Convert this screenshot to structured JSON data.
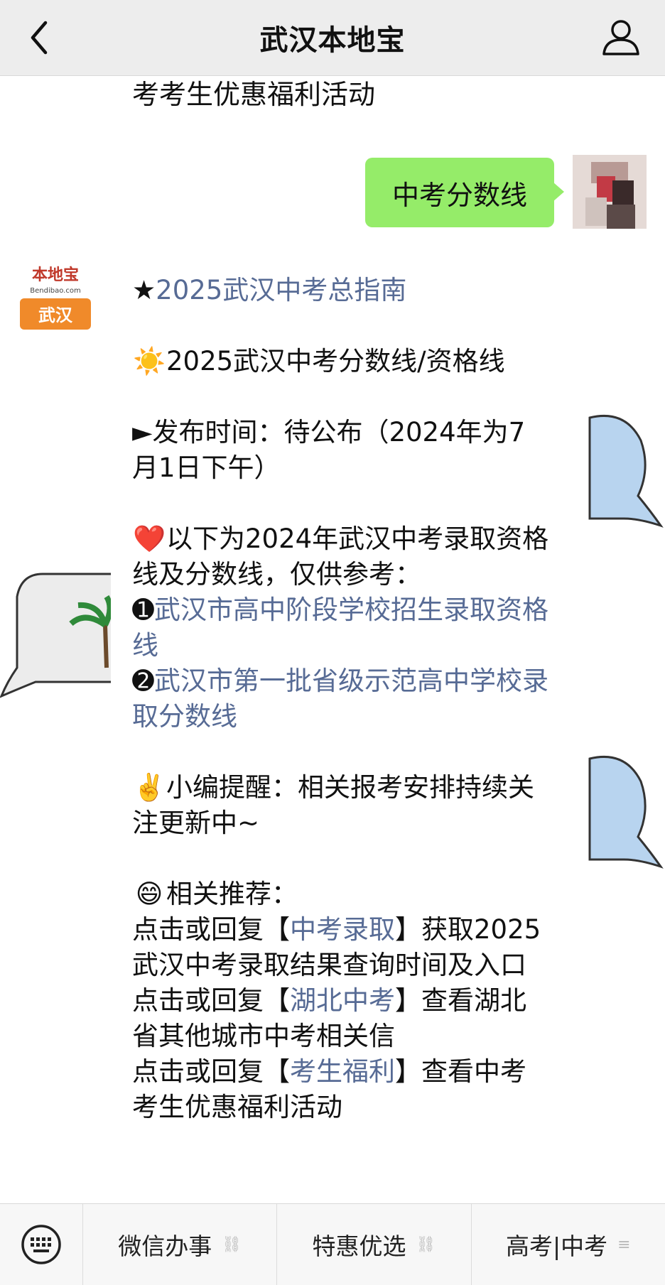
{
  "header": {
    "title": "武汉本地宝",
    "back_icon": "chevron-left-icon",
    "profile_icon": "person-icon"
  },
  "chat": {
    "previous_tail": "考考生优惠福利活动",
    "user_message": "中考分数线",
    "bot_avatar": {
      "top": "本地宝",
      "sub": "Bendibao.com",
      "city": "武汉",
      "accent": "#f08a2a"
    },
    "bot_message": {
      "star": "★",
      "guide_link": "2025武汉中考总指南",
      "sun_emoji": "☀️",
      "score_heading": "2025武汉中考分数线/资格线",
      "release_prefix": "►发布时间：待公布（2024年为7月1日下午）",
      "heart_emoji": "❤️",
      "ref_text": "以下为2024年武汉中考录取资格线及分数线，仅供参考：",
      "item1_num": "➊",
      "item1_link": "武汉市高中阶段学校招生录取资格线",
      "item2_num": "➋",
      "item2_link": "武汉市第一批省级示范高中学校录取分数线",
      "victory_emoji": "✌️",
      "reminder": "小编提醒：相关报考安排持续关注更新中~",
      "grin_emoji": "😄",
      "related_heading": "相关推荐：",
      "click_reply": "点击或回复",
      "bracket_open": "【",
      "bracket_close": "】",
      "rec1_link": "中考录取",
      "rec1_tail": "获取2025武汉中考录取结果查询时间及入口",
      "rec2_link": "湖北中考",
      "rec2_tail": "查看湖北省其他城市中考相关信",
      "rec3_link": "考生福利",
      "rec3_tail": "查看中考考生优惠福利活动"
    }
  },
  "bottom_menu": {
    "keyboard_icon": "keyboard-icon",
    "items": [
      {
        "label": "微信办事",
        "icon": "link-icon"
      },
      {
        "label": "特惠优选",
        "icon": "link-icon"
      },
      {
        "label": "高考|中考",
        "icon": "menu-lines-icon"
      }
    ]
  },
  "colors": {
    "header_bg": "#ededed",
    "user_bubble": "#95ec69",
    "link": "#576b95",
    "menu_bg": "#f7f7f7"
  }
}
